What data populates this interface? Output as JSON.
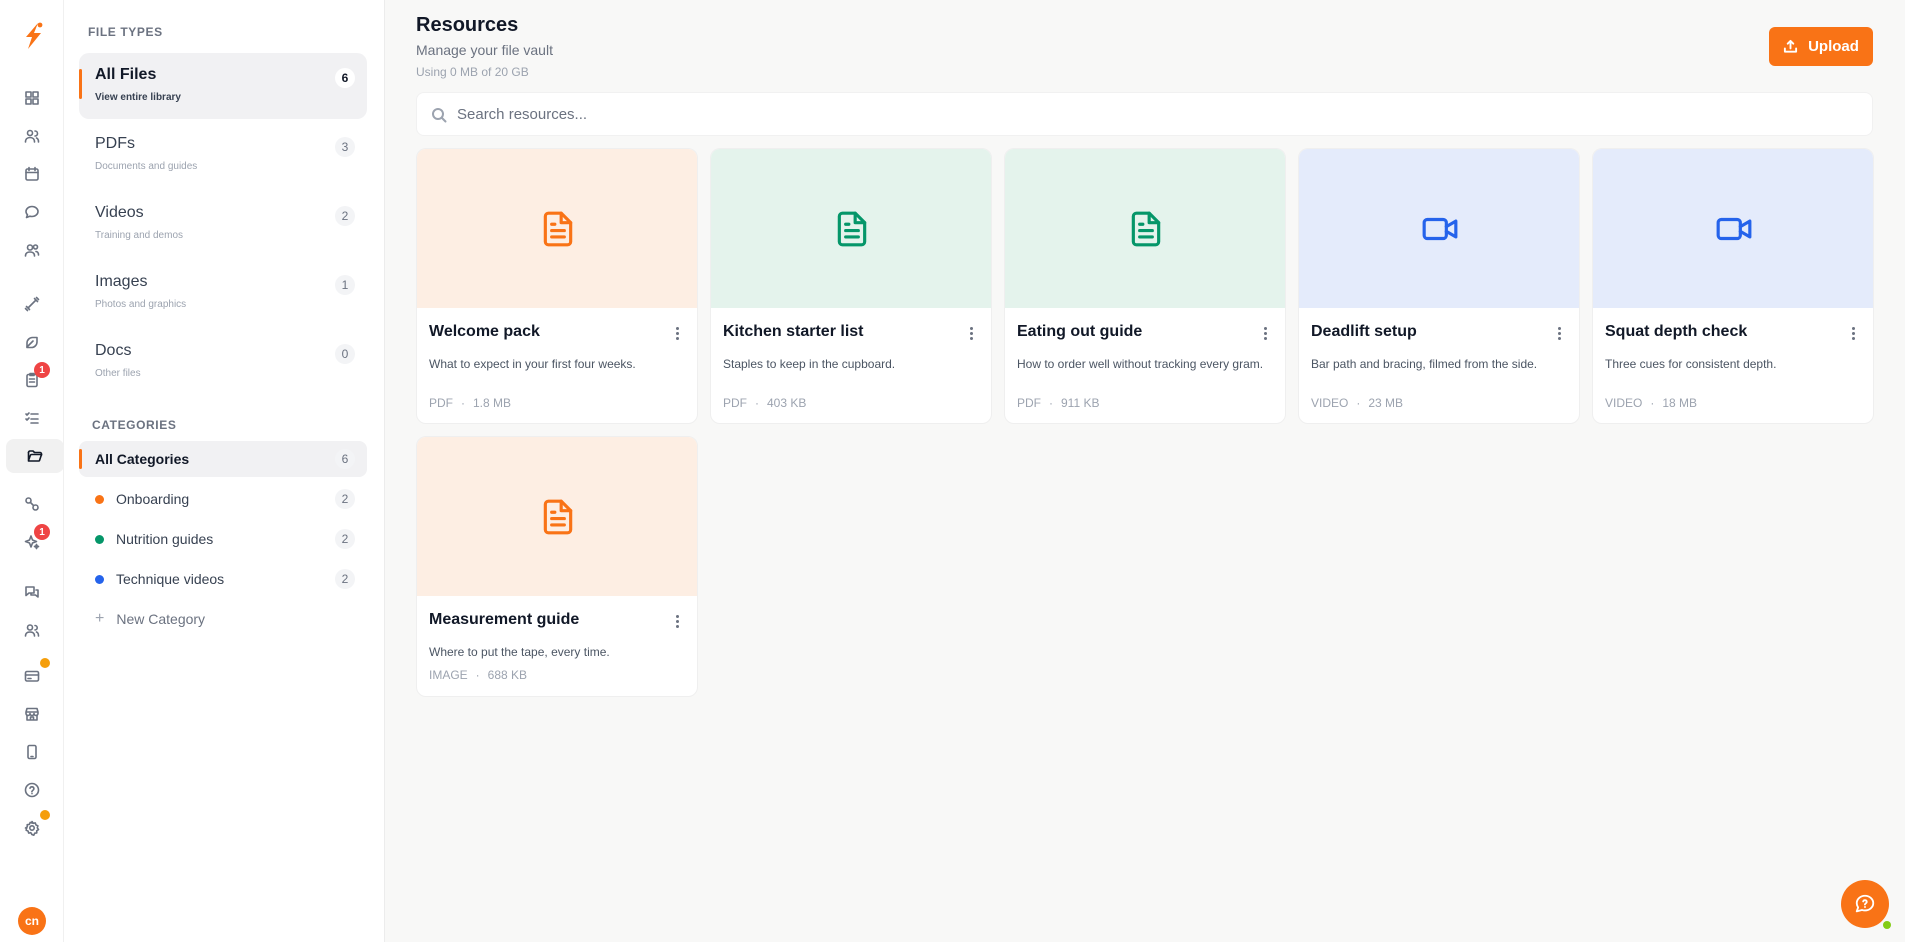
{
  "app": {
    "avatar_initials": "cn",
    "accent_color": "#f97316"
  },
  "rail": {
    "items": [
      {
        "name": "dashboard-icon",
        "badge": null
      },
      {
        "name": "clients-icon",
        "badge": null
      },
      {
        "name": "calendar-icon",
        "badge": null
      },
      {
        "name": "messages-icon",
        "badge": null
      },
      {
        "name": "team-icon",
        "badge": null
      },
      {
        "name": "workouts-icon",
        "badge": null
      },
      {
        "name": "nutrition-icon",
        "badge": null
      },
      {
        "name": "forms-icon",
        "badge": "1"
      },
      {
        "name": "tasks-icon",
        "badge": null
      },
      {
        "name": "resources-icon",
        "badge": null,
        "active": true
      },
      {
        "name": "automations-icon",
        "badge": null
      },
      {
        "name": "ai-icon",
        "badge": "1"
      },
      {
        "name": "community-icon",
        "badge": null
      },
      {
        "name": "leads-icon",
        "badge": null
      },
      {
        "name": "billing-icon",
        "badge": "dot"
      },
      {
        "name": "store-icon",
        "badge": null
      },
      {
        "name": "mobile-icon",
        "badge": null
      },
      {
        "name": "help-icon",
        "badge": null
      },
      {
        "name": "settings-icon",
        "badge": "dot"
      }
    ]
  },
  "sidebar": {
    "file_types_heading": "FILE TYPES",
    "file_types": [
      {
        "title": "All Files",
        "subtitle": "View entire library",
        "count": "6",
        "active": true
      },
      {
        "title": "PDFs",
        "subtitle": "Documents and guides",
        "count": "3"
      },
      {
        "title": "Videos",
        "subtitle": "Training and demos",
        "count": "2"
      },
      {
        "title": "Images",
        "subtitle": "Photos and graphics",
        "count": "1"
      },
      {
        "title": "Docs",
        "subtitle": "Other files",
        "count": "0"
      }
    ],
    "categories_heading": "CATEGORIES",
    "categories": [
      {
        "label": "All Categories",
        "count": "6",
        "active": true
      },
      {
        "label": "Onboarding",
        "count": "2",
        "color": "#f97316"
      },
      {
        "label": "Nutrition guides",
        "count": "2",
        "color": "#059669"
      },
      {
        "label": "Technique videos",
        "count": "2",
        "color": "#2563eb"
      }
    ],
    "new_category_label": "New Category"
  },
  "header": {
    "title": "Resources",
    "subtitle": "Manage your file vault",
    "usage": "Using 0 MB of 20 GB",
    "upload_label": "Upload"
  },
  "search": {
    "placeholder": "Search resources...",
    "value": ""
  },
  "cards": [
    {
      "title": "Welcome pack",
      "description": "What to expect in your first four weeks.",
      "type": "PDF",
      "size": "1.8 MB",
      "icon": "document-icon",
      "thumb_bg": "#fdeee3",
      "icon_color": "#f97316"
    },
    {
      "title": "Kitchen starter list",
      "description": "Staples to keep in the cupboard.",
      "type": "PDF",
      "size": "403 KB",
      "icon": "document-icon",
      "thumb_bg": "#e4f3ec",
      "icon_color": "#059669"
    },
    {
      "title": "Eating out guide",
      "description": "How to order well without tracking every gram.",
      "type": "PDF",
      "size": "911 KB",
      "icon": "document-icon",
      "thumb_bg": "#e4f3ec",
      "icon_color": "#059669"
    },
    {
      "title": "Deadlift setup",
      "description": "Bar path and bracing, filmed from the side.",
      "type": "VIDEO",
      "size": "23 MB",
      "icon": "video-icon",
      "thumb_bg": "#e4ebfb",
      "icon_color": "#2563eb"
    },
    {
      "title": "Squat depth check",
      "description": "Three cues for consistent depth.",
      "type": "VIDEO",
      "size": "18 MB",
      "icon": "video-icon",
      "thumb_bg": "#e4ebfb",
      "icon_color": "#2563eb"
    },
    {
      "title": "Measurement guide",
      "description": "Where to put the tape, every time.",
      "type": "IMAGE",
      "size": "688 KB",
      "icon": "document-icon",
      "thumb_bg": "#fdeee3",
      "icon_color": "#f97316"
    }
  ],
  "meta_separator": "·"
}
